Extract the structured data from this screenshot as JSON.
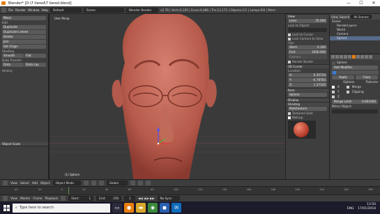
{
  "window": {
    "title": "Blender* [D:\\7 tiered\\7 tiered.blend]",
    "minimize": "—",
    "maximize": "☐",
    "close": "✕"
  },
  "topbar": {
    "menus": [
      "File",
      "Render",
      "Window",
      "Help"
    ],
    "layout": "Default",
    "scene": "Scene",
    "engine": "Blender Render",
    "stats": "v2.79 | Verts:6,105 | Faces:6,086 | Tris:12,172 | Objects:1/1 | Lamps:0/0 | Mem:"
  },
  "tool_shelf": {
    "header": "Tools",
    "sections": [
      {
        "title": "Move"
      },
      {
        "title": "Edit",
        "buttons": [
          "Duplicate",
          "Duplicate Linked",
          "Delete",
          "Join",
          "Set Origin"
        ]
      },
      {
        "title": "Shading",
        "buttons": [
          "Smooth",
          "Flat"
        ]
      },
      {
        "title": "Data Transfer",
        "buttons": [
          "Data",
          "Data Lay"
        ]
      },
      {
        "title": "History"
      }
    ],
    "operator_panel": "Object Scale"
  },
  "viewport": {
    "view_label": "User Persp",
    "object_label": "(1) Sphere"
  },
  "nprops": {
    "view": {
      "header": "View",
      "lens_label": "Lens:",
      "lens_value": "35.000",
      "lock_object": "Lock to Object:",
      "lock_cursor": "Lock to Cursor",
      "lock_camera": "Lock Camera to View"
    },
    "clip": {
      "header": "Clip:",
      "start_label": "Start:",
      "start_value": "0.100",
      "end_label": "End:",
      "end_value": "1000.000"
    },
    "local_camera": "Camera",
    "render_border": "Render Border",
    "cursor": {
      "header": "3D Cursor",
      "location": "Location:",
      "x_label": "X:",
      "x_value": "0.35734",
      "y_label": "Y:",
      "y_value": "-0.78783",
      "z_label": "Z:",
      "z_value": "1.37320"
    },
    "item": {
      "header": "Item",
      "name": "Sphere"
    },
    "display": "Display",
    "shading": {
      "header": "Shading",
      "mode": "Multitexture",
      "textured_solid": "Textured Solid",
      "matcap": "Matcap"
    }
  },
  "outliner": {
    "view": "View",
    "search": "Search",
    "mode": "All Scenes",
    "items": [
      "Scene",
      "RenderLayers",
      "World",
      "Camera",
      "Sphere"
    ]
  },
  "properties": {
    "object": "Sphere",
    "add_modifier": "Add Modifier",
    "apply": "Apply",
    "copy": "Copy",
    "options": "Options",
    "textures": "Textures",
    "x": "X",
    "y": "Y",
    "z": "Z",
    "merge": "Merge",
    "clipping": "Clipping",
    "merge_limit_label": "Merge Limit:",
    "merge_limit_value": "0.001000",
    "mirror_object": "Mirror Object:"
  },
  "bottom_header": {
    "menus": [
      "View",
      "Select",
      "Add",
      "Object"
    ],
    "mode": "Object Mode",
    "pivot": "Global"
  },
  "timeline": {
    "ticks": [
      "-40",
      "-20",
      "0",
      "20",
      "40",
      "60",
      "80",
      "100",
      "120",
      "140",
      "160",
      "180",
      "200",
      "220",
      "240",
      "260"
    ]
  },
  "playbar": {
    "menus": [
      "View",
      "Marker",
      "Frame",
      "Playback"
    ],
    "start_label": "Start:",
    "start_value": "1",
    "end_label": "End:",
    "end_value": "250",
    "current": "1",
    "sync": "No Sync"
  },
  "taskbar": {
    "search_placeholder": "Type here to search",
    "lang": "ENG",
    "time": "13:50",
    "date": "17/01/2018"
  },
  "colors": {
    "accent": "#e87d0d",
    "head": "#c46f5e"
  },
  "icons": [
    "windows-start-icon",
    "search-icon",
    "blender-icon",
    "folder-icon",
    "chrome-icon",
    "store-icon",
    "mail-icon"
  ]
}
